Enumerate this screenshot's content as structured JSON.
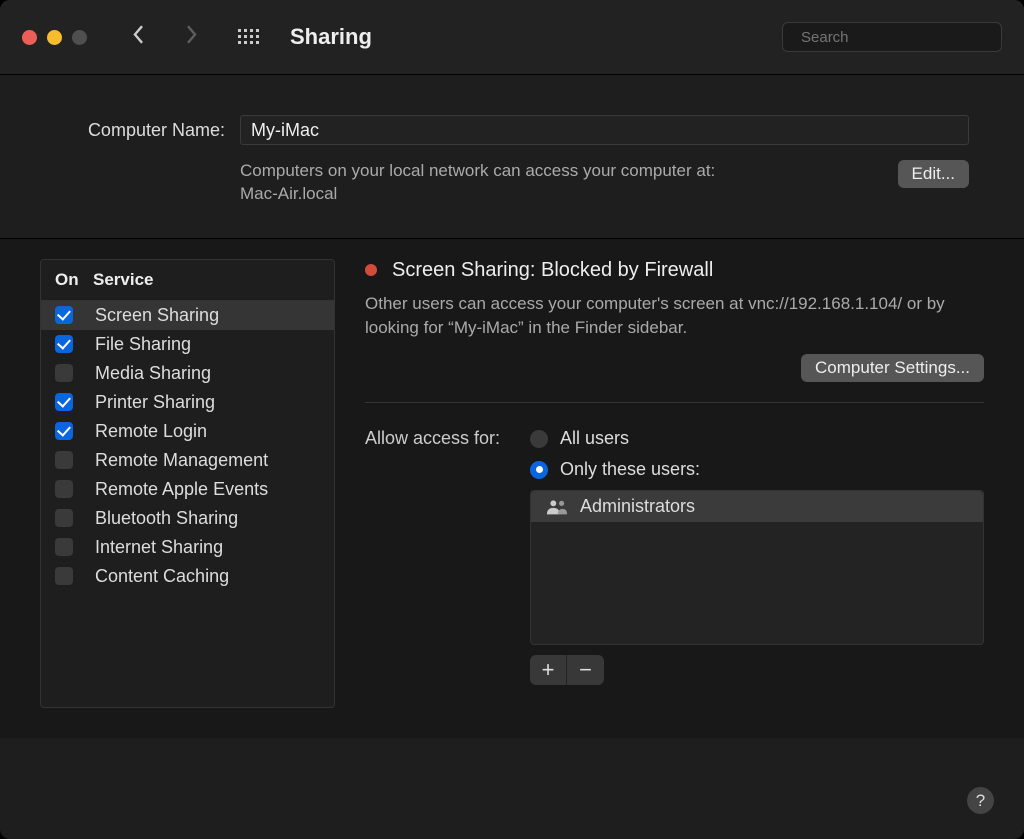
{
  "header": {
    "title": "Sharing",
    "search_placeholder": "Search"
  },
  "computer": {
    "label": "Computer Name:",
    "value": "My-iMac",
    "subtext1": "Computers on your local network can access your computer at:",
    "subtext2": "Mac-Air.local",
    "edit_label": "Edit..."
  },
  "services": {
    "header_on": "On",
    "header_service": "Service",
    "items": [
      {
        "label": "Screen Sharing",
        "on": true,
        "selected": true
      },
      {
        "label": "File Sharing",
        "on": true,
        "selected": false
      },
      {
        "label": "Media Sharing",
        "on": false,
        "selected": false
      },
      {
        "label": "Printer Sharing",
        "on": true,
        "selected": false
      },
      {
        "label": "Remote Login",
        "on": true,
        "selected": false
      },
      {
        "label": "Remote Management",
        "on": false,
        "selected": false
      },
      {
        "label": "Remote Apple Events",
        "on": false,
        "selected": false
      },
      {
        "label": "Bluetooth Sharing",
        "on": false,
        "selected": false
      },
      {
        "label": "Internet Sharing",
        "on": false,
        "selected": false
      },
      {
        "label": "Content Caching",
        "on": false,
        "selected": false
      }
    ]
  },
  "detail": {
    "status": "Screen Sharing: Blocked by Firewall",
    "description": "Other users can access your computer's screen at vnc://192.168.1.104/ or by looking for “My-iMac” in the Finder sidebar.",
    "settings_btn": "Computer Settings...",
    "access_label": "Allow access for:",
    "radios": {
      "all": "All users",
      "only": "Only these users:"
    },
    "users": [
      "Administrators"
    ],
    "add": "+",
    "remove": "−"
  },
  "help": "?"
}
